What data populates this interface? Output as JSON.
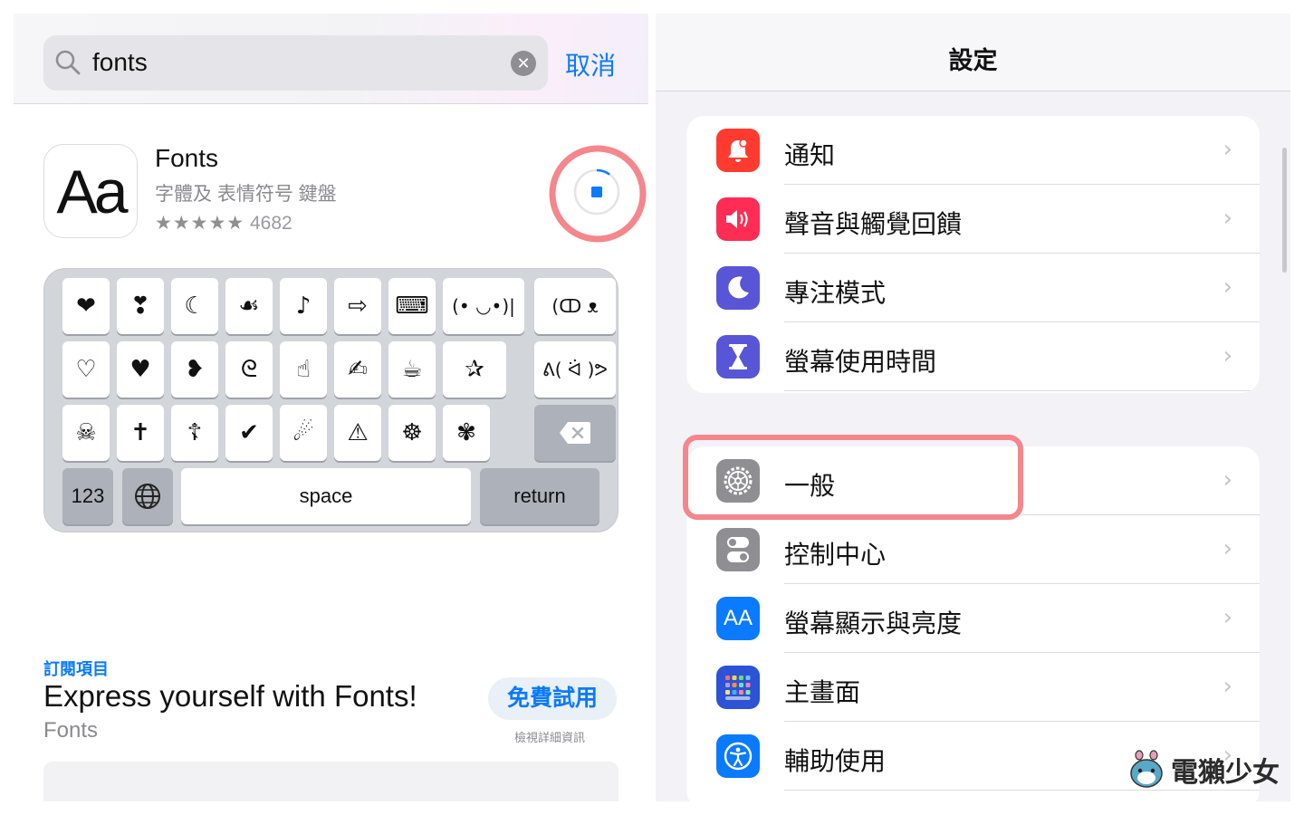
{
  "left": {
    "search": {
      "value": "fonts",
      "clear_icon": "clear-icon",
      "cancel_label": "取消"
    },
    "app": {
      "icon_text": "Aa",
      "name": "Fonts",
      "subtitle": "字體及 表情符号 鍵盤",
      "stars": "★★★★★",
      "rating_count": "4682",
      "download_progress": 0.1
    },
    "keyboard": {
      "row1": [
        "❤",
        "❣",
        "☾",
        "☙",
        "♪",
        "⇨",
        "⌨"
      ],
      "row1_wide": [
        "(• ◡•)|",
        "(ↀ ᴥ ↀ)"
      ],
      "row2": [
        "♡",
        "♥",
        "❥",
        "ᘓ",
        "☝",
        "✍",
        "☕",
        "✰"
      ],
      "row2_wide": [
        "ᕕ( ᐛ )ᕗ"
      ],
      "row3": [
        "☠",
        "✝",
        "☦",
        "✔",
        "☄",
        "⚠",
        "☸",
        "✾"
      ],
      "num_label": "123",
      "globe_icon": "globe-icon",
      "space_label": "space",
      "return_label": "return",
      "delete_icon": "delete-icon"
    },
    "subscription": {
      "section_label": "訂閱項目",
      "title": "Express yourself with Fonts!",
      "app_name": "Fonts",
      "trial_button": "免費試用",
      "trial_note": "檢視詳細資訊"
    }
  },
  "right": {
    "title": "設定",
    "group1": [
      {
        "label": "通知",
        "icon": "bell-icon",
        "color": "#ff3b30"
      },
      {
        "label": "聲音與觸覺回饋",
        "icon": "speaker-icon",
        "color": "#ff2d55"
      },
      {
        "label": "專注模式",
        "icon": "moon-icon",
        "color": "#5856d6"
      },
      {
        "label": "螢幕使用時間",
        "icon": "hourglass-icon",
        "color": "#5856d6"
      }
    ],
    "group2": [
      {
        "label": "一般",
        "icon": "gear-icon",
        "color": "#8e8e93"
      },
      {
        "label": "控制中心",
        "icon": "toggles-icon",
        "color": "#8e8e93"
      },
      {
        "label": "螢幕顯示與亮度",
        "icon": "display-icon",
        "color": "#0a7aff",
        "icon_text": "AA"
      },
      {
        "label": "主畫面",
        "icon": "home-grid-icon",
        "color": "#2c52d6"
      },
      {
        "label": "輔助使用",
        "icon": "accessibility-icon",
        "color": "#0a7aff"
      }
    ],
    "chevron": "›"
  },
  "watermark": {
    "text": "電獺少女"
  }
}
